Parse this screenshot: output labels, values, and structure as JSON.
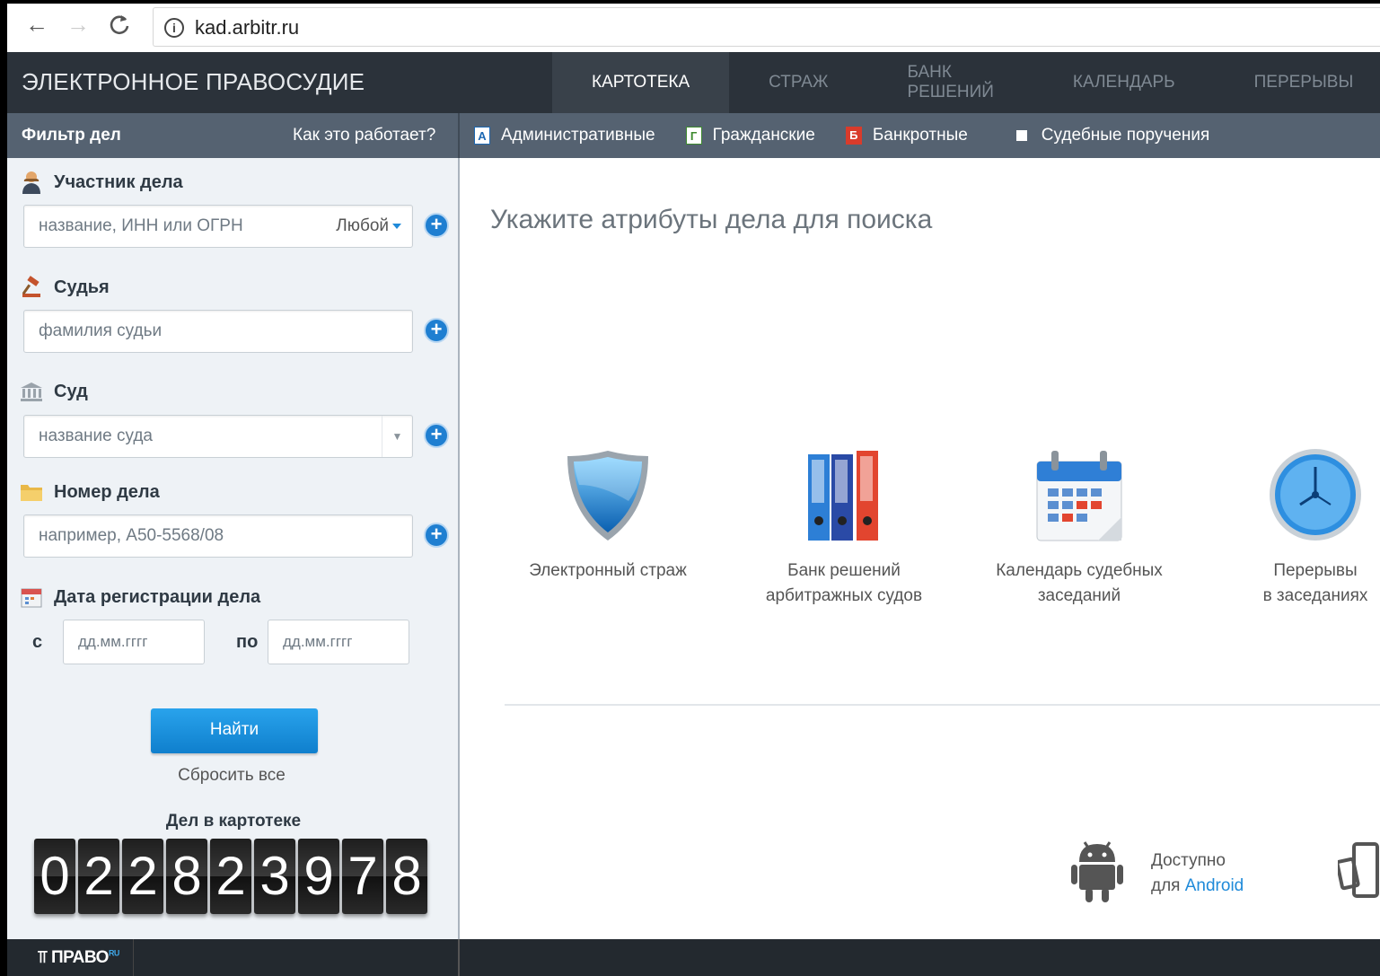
{
  "browser": {
    "back": "←",
    "forward": "→",
    "reload": "C",
    "info": "i",
    "url": "kad.arbitr.ru"
  },
  "header": {
    "brand": "ЭЛЕКТРОННОЕ ПРАВОСУДИЕ",
    "nav": [
      "КАРТОТЕКА",
      "СТРАЖ",
      "БАНК РЕШЕНИЙ",
      "КАЛЕНДАРЬ",
      "ПЕРЕРЫВЫ"
    ],
    "active": "КАРТОТЕКА"
  },
  "filter_bar": {
    "title": "Фильтр дел",
    "how_link": "Как это работает?",
    "case_types": [
      {
        "badge": "А",
        "label": "Административные"
      },
      {
        "badge": "Г",
        "label": "Гражданские"
      },
      {
        "badge": "Б",
        "label": "Банкротные"
      },
      {
        "badge": "",
        "label": "Судебные поручения"
      }
    ]
  },
  "sidebar": {
    "participant": {
      "label": "Участник дела",
      "placeholder": "название, ИНН или ОГРН",
      "type_value": "Любой"
    },
    "judge": {
      "label": "Судья",
      "placeholder": "фамилия судьи"
    },
    "court": {
      "label": "Суд",
      "placeholder": "название суда"
    },
    "case_number": {
      "label": "Номер дела",
      "placeholder": "например, А50-5568/08"
    },
    "reg_date": {
      "label": "Дата регистрации дела",
      "from_label": "с",
      "to_label": "по",
      "from_placeholder": "дд.мм.гггг",
      "to_placeholder": "дд.мм.гггг"
    },
    "find_button": "Найти",
    "reset_link": "Сбросить все",
    "count_label": "Дел в картотеке",
    "count_digits": [
      "0",
      "2",
      "2",
      "8",
      "2",
      "3",
      "9",
      "7",
      "8"
    ]
  },
  "main": {
    "title": "Укажите атрибуты дела для поиска",
    "features": [
      {
        "icon": "shield-icon",
        "line1": "Электронный страж",
        "line2": ""
      },
      {
        "icon": "binders-icon",
        "line1": "Банк решений",
        "line2": "арбитражных судов"
      },
      {
        "icon": "calendar-icon",
        "line1": "Календарь судебных",
        "line2": "заседаний"
      },
      {
        "icon": "clock-icon",
        "line1": "Перерывы",
        "line2": "в заседаниях"
      }
    ],
    "android": {
      "line1": "Доступно",
      "prefix": "для ",
      "link": "Android"
    }
  },
  "footer": {
    "logo": "ПРАВО",
    "logo_sup": "RU"
  },
  "colors": {
    "header_bg": "#2b323a",
    "filter_bg": "#556271",
    "sidebar_bg": "#eef2f6",
    "accent": "#1f8ad9"
  }
}
